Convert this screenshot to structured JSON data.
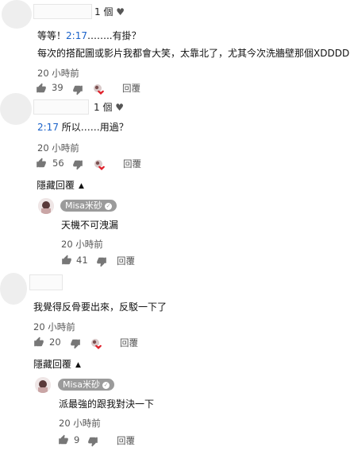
{
  "comments": [
    {
      "likes_label": "1 個",
      "heart": "♥",
      "text_prefix": "等等！",
      "timestamp_link": "2:17",
      "text_suffix": "……..有掛？",
      "text_line2": "每次的搭配圖或影片我都會大笑，太靠北了，尤其今次洗牆壁那個XDDDD",
      "time": "20 小時前",
      "like_count": "39",
      "reply_label": "回覆"
    },
    {
      "likes_label": "1 個",
      "heart": "♥",
      "timestamp_link": "2:17",
      "text_suffix": " 所以……用過？",
      "time": "20 小時前",
      "like_count": "56",
      "reply_label": "回覆",
      "hide_replies_label": "隱藏回覆",
      "reply": {
        "author": "Misa米砂",
        "text": "天機不可洩漏",
        "time": "20 小時前",
        "like_count": "41",
        "reply_label": "回覆"
      }
    },
    {
      "text": "我覺得反骨要出來，反駁一下了",
      "time": "20 小時前",
      "like_count": "20",
      "reply_label": "回覆",
      "hide_replies_label": "隱藏回覆",
      "reply": {
        "author": "Misa米砂",
        "text": "派最強的跟我對決一下",
        "time": "20 小時前",
        "like_count": "9",
        "reply_label": "回覆"
      }
    }
  ],
  "icons": {
    "like": "thumbs-up-icon",
    "dislike": "thumbs-down-icon",
    "creator_heart": "creator-heart-icon",
    "chevron": "chevron-up-icon",
    "verified": "verified-check-icon"
  },
  "colors": {
    "timestamp_link": "#1a62c9",
    "badge_bg": "#9b9b9b",
    "heart_red": "#e0202a"
  }
}
